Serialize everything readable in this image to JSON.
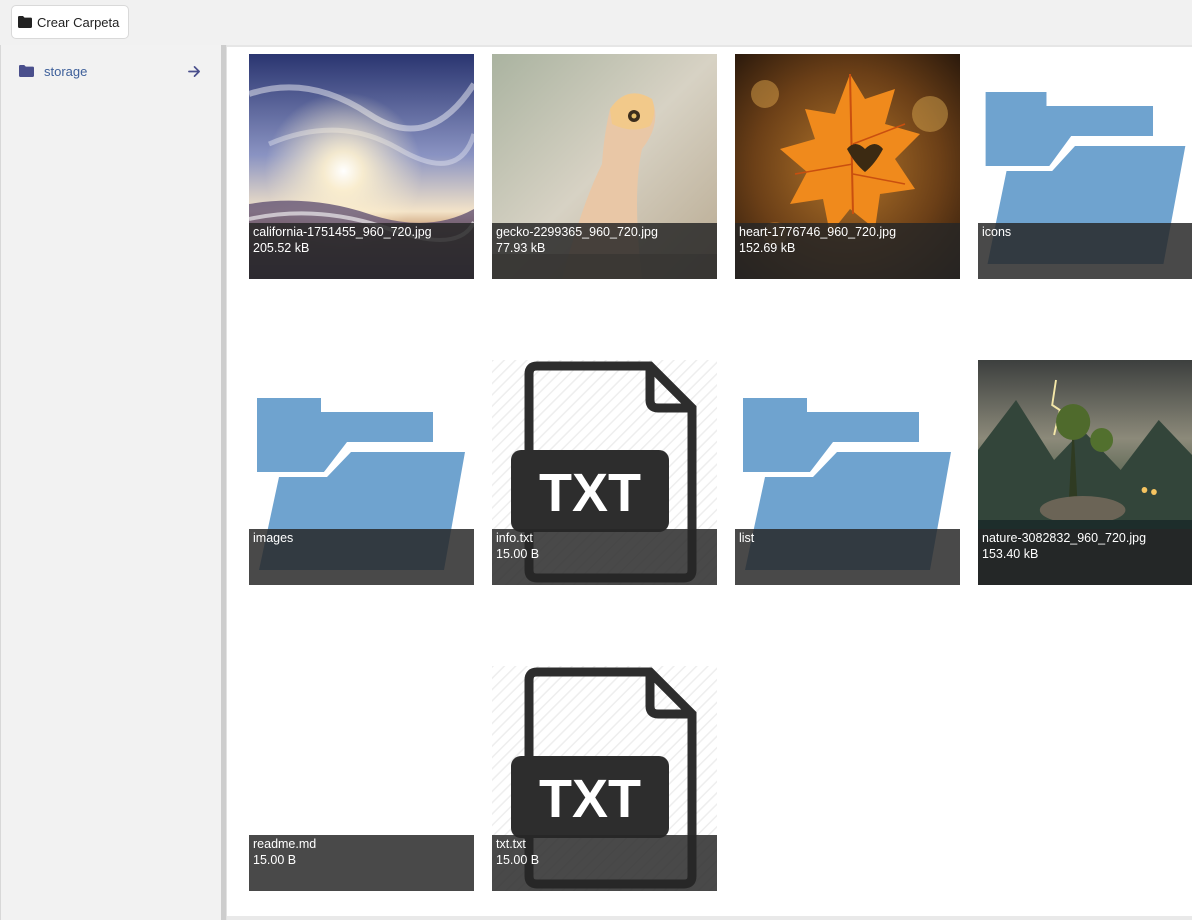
{
  "toolbar": {
    "create_folder_label": "Crear Carpeta"
  },
  "sidebar": {
    "items": [
      {
        "label": "storage",
        "icon": "folder-icon",
        "action_icon": "arrow-right-icon"
      }
    ]
  },
  "colors": {
    "folder_accent": "#4a4f8c",
    "link": "#3d5f9a",
    "folder_blue": "#6fa3cf",
    "caption_bg": "#262626"
  },
  "files": [
    {
      "name": "california-1751455_960_720.jpg",
      "size": "205.52 kB",
      "kind": "image"
    },
    {
      "name": "gecko-2299365_960_720.jpg",
      "size": "77.93 kB",
      "kind": "image"
    },
    {
      "name": "heart-1776746_960_720.jpg",
      "size": "152.69 kB",
      "kind": "image"
    },
    {
      "name": "icons",
      "size": "",
      "kind": "folder"
    },
    {
      "name": "images",
      "size": "",
      "kind": "folder"
    },
    {
      "name": "info.txt",
      "size": "15.00 B",
      "kind": "txt"
    },
    {
      "name": "list",
      "size": "",
      "kind": "folder"
    },
    {
      "name": "nature-3082832_960_720.jpg",
      "size": "153.40 kB",
      "kind": "image"
    },
    {
      "name": "readme.md",
      "size": "15.00 B",
      "kind": "blank"
    },
    {
      "name": "txt.txt",
      "size": "15.00 B",
      "kind": "txt"
    }
  ]
}
